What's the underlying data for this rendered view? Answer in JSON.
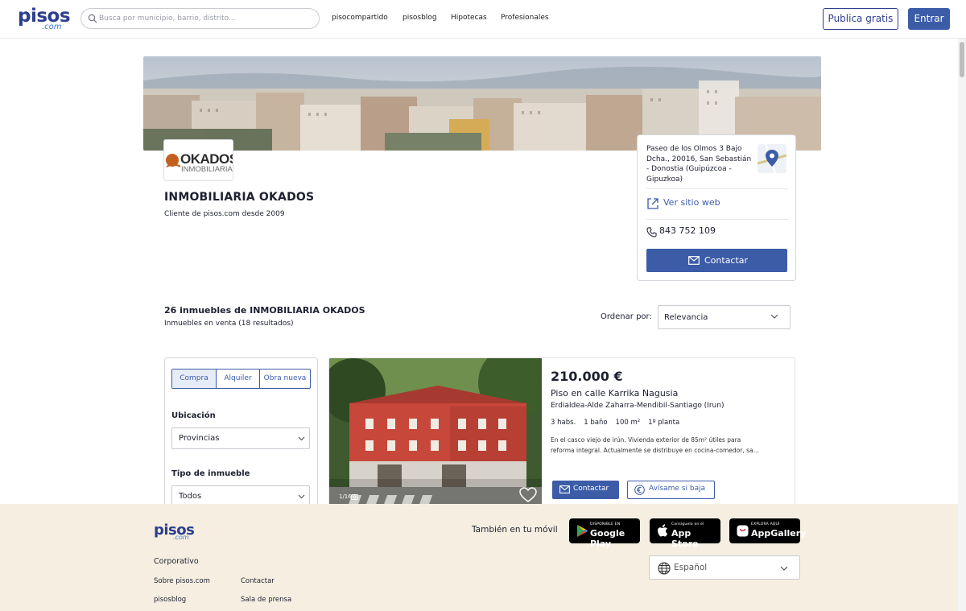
{
  "header": {
    "logo_text": "pisos",
    "logo_suffix": ".com",
    "search_placeholder": "Busca por municipio, barrio, distrito...",
    "nav": [
      "pisocompartido",
      "pisosblog",
      "Hipotecas",
      "Profesionales"
    ],
    "publish_label": "Publica gratis",
    "login_label": "Entrar"
  },
  "agency": {
    "logo_text_main": "OKADOS",
    "logo_text_sub": "INMOBILIARIA",
    "name": "INMOBILIARIA OKADOS",
    "since": "Cliente de pisos.com desde 2009"
  },
  "contact_card": {
    "address": "Paseo de los Olmos 3 Bajo Dcha., 20016, San Sebastián - Donostia (Guipúzcoa - Gipuzkoa)",
    "website_label": "Ver sitio web",
    "phone": "843 752 109",
    "contact_label": "Contactar"
  },
  "results": {
    "title": "26 inmuebles de INMOBILIARIA OKADOS",
    "subtitle": "Inmuebles en venta (18 resultados)",
    "sort_label": "Ordenar por:",
    "sort_value": "Relevancia"
  },
  "filters": {
    "tabs": [
      "Compra",
      "Alquiler",
      "Obra nueva"
    ],
    "active_tab": "Compra",
    "location_label": "Ubicación",
    "location_value": "Provincias",
    "type_label": "Tipo de inmueble",
    "type_value": "Todos"
  },
  "listing": {
    "photo_count": "1/16",
    "price": "210.000 €",
    "title": "Piso en calle Karrika Nagusia",
    "location": "Erdialdea-Alde Zaharra-Mendibil-Santiago (Irun)",
    "features": [
      "3 habs.",
      "1 baño",
      "100 m²",
      "1º planta"
    ],
    "description_line1": "En el casco viejo de irún. Vivienda exterior de 85m² útiles para",
    "description_line2": "reforma integral. Actualmente se distribuye en cocina-comedor, sa...",
    "contact_label": "Contactar",
    "alert_label": "Avísame si baja"
  },
  "footer": {
    "logo_text": "pisos",
    "logo_suffix": ".com",
    "corporate_label": "Corporativo",
    "links": [
      "Sobre pisos.com",
      "Contactar",
      "pisosblog",
      "Sala de prensa"
    ],
    "mobile_text": "También en tu móvil",
    "google_play_small": "DISPONIBLE EN",
    "google_play_big": "Google Play",
    "app_store_small": "Consíguelo en el",
    "app_store_big": "App Store",
    "appgallery_small": "EXPLORA AQUÍ",
    "appgallery_big": "AppGallery",
    "language": "Español"
  },
  "colors": {
    "brand_blue": "#3c5ca8",
    "logo_blue": "#2c3e8f",
    "footer_bg": "#f6efe1"
  },
  "icons": [
    "search-icon",
    "map-pin-icon",
    "external-link-icon",
    "phone-icon",
    "mail-icon",
    "chevron-down-icon",
    "camera-icon",
    "heart-icon",
    "euro-icon",
    "globe-icon",
    "google-play-icon",
    "apple-icon",
    "appgallery-icon"
  ]
}
